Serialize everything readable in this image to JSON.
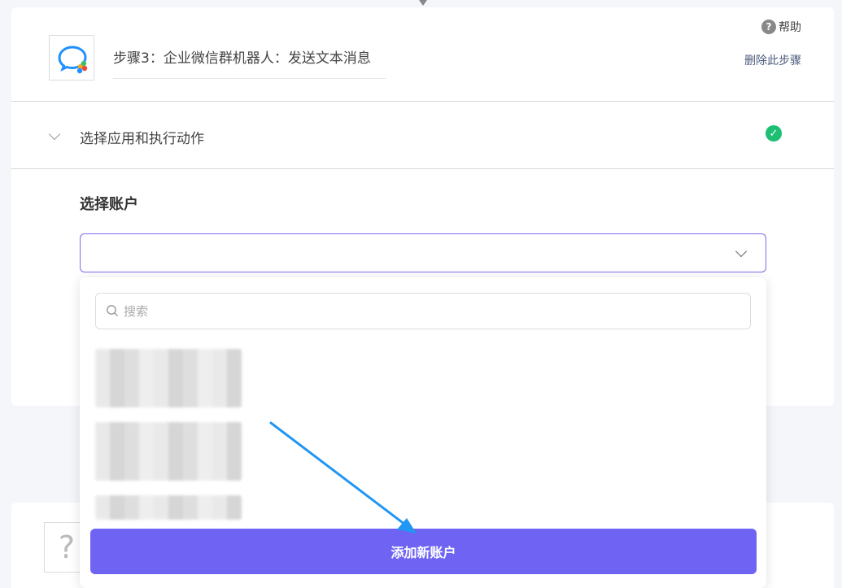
{
  "step": {
    "title": "步骤3：企业微信群机器人：发送文本消息",
    "help_label": "帮助",
    "help_icon_glyph": "?",
    "delete_label": "删除此步骤",
    "app_icon": "wecom-logo-icon"
  },
  "section": {
    "title": "选择应用和执行动作",
    "status_icon": "check-circle-icon",
    "status_color": "#1dbf73"
  },
  "account": {
    "label": "选择账户",
    "selected_value": ""
  },
  "dropdown": {
    "search_placeholder": "搜索",
    "items": [
      {
        "label": "",
        "blurred": true
      },
      {
        "label": "",
        "blurred": true
      },
      {
        "label": "",
        "blurred": true
      }
    ],
    "add_button_label": "添加新账户"
  },
  "next_step": {
    "icon_glyph": "?"
  },
  "colors": {
    "accent": "#6e63f3",
    "select_border": "#7b6cf0",
    "annotation": "#2196f3"
  }
}
